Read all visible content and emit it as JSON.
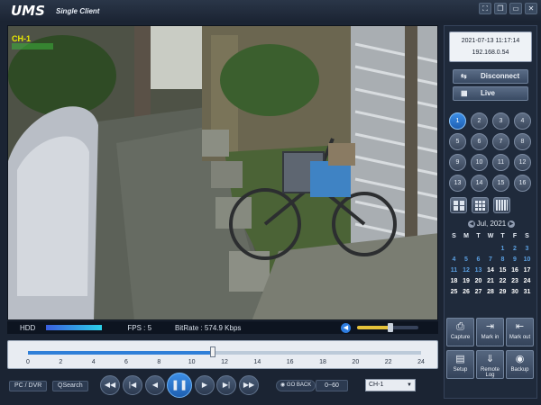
{
  "app": {
    "logo": "UMS",
    "subtitle": "Single Client"
  },
  "window_controls": [
    "fullscreen-icon",
    "restore-icon",
    "maximize-icon",
    "close-icon"
  ],
  "video": {
    "channel_label": "CH-1"
  },
  "status": {
    "hdd_label": "HDD",
    "hdd_level": 1.0,
    "fps_text": "FPS :  5",
    "bitrate_text": "BitRate : 574.9 Kbps",
    "volume_level": 0.55
  },
  "timeline": {
    "ticks": [
      "0",
      "2",
      "4",
      "6",
      "8",
      "10",
      "12",
      "14",
      "16",
      "18",
      "20",
      "22",
      "24"
    ],
    "position_hours": 11.3
  },
  "controls": {
    "pc_dvr": "PC / DVR",
    "qsearch": "QSearch",
    "playback_icons": [
      "fast-rewind-icon",
      "skip-back-icon",
      "step-back-icon",
      "pause-icon",
      "step-forward-icon",
      "skip-forward-icon",
      "fast-forward-icon"
    ],
    "go_back": "GO BACK",
    "range": "0~60",
    "channel_select": "CH-1"
  },
  "info": {
    "datetime": "2021-07-13 11:17:14",
    "ip": "192.168.0.54"
  },
  "buttons": {
    "disconnect": "Disconnect",
    "live": "Live"
  },
  "channels": [
    "1",
    "2",
    "3",
    "4",
    "5",
    "6",
    "7",
    "8",
    "9",
    "10",
    "11",
    "12",
    "13",
    "14",
    "15",
    "16"
  ],
  "active_channel": "1",
  "calendar": {
    "title": "Jul, 2021",
    "dow": [
      "S",
      "M",
      "T",
      "W",
      "T",
      "F",
      "S"
    ],
    "weeks": [
      [
        "",
        "",
        "",
        "",
        "1",
        "2",
        "3"
      ],
      [
        "4",
        "5",
        "6",
        "7",
        "8",
        "9",
        "10"
      ],
      [
        "11",
        "12",
        "13",
        "14",
        "15",
        "16",
        "17"
      ],
      [
        "18",
        "19",
        "20",
        "21",
        "22",
        "23",
        "24"
      ],
      [
        "25",
        "26",
        "27",
        "28",
        "29",
        "30",
        "31"
      ]
    ],
    "recorded_from": 14
  },
  "tools": [
    "Capture",
    "Mark in",
    "Mark out",
    "Setup",
    "Remote Log",
    "Backup"
  ],
  "colors": {
    "accent": "#2f7fd8",
    "channel_label": "#e8e800",
    "calendar_no_record": "#5a9fe0"
  }
}
